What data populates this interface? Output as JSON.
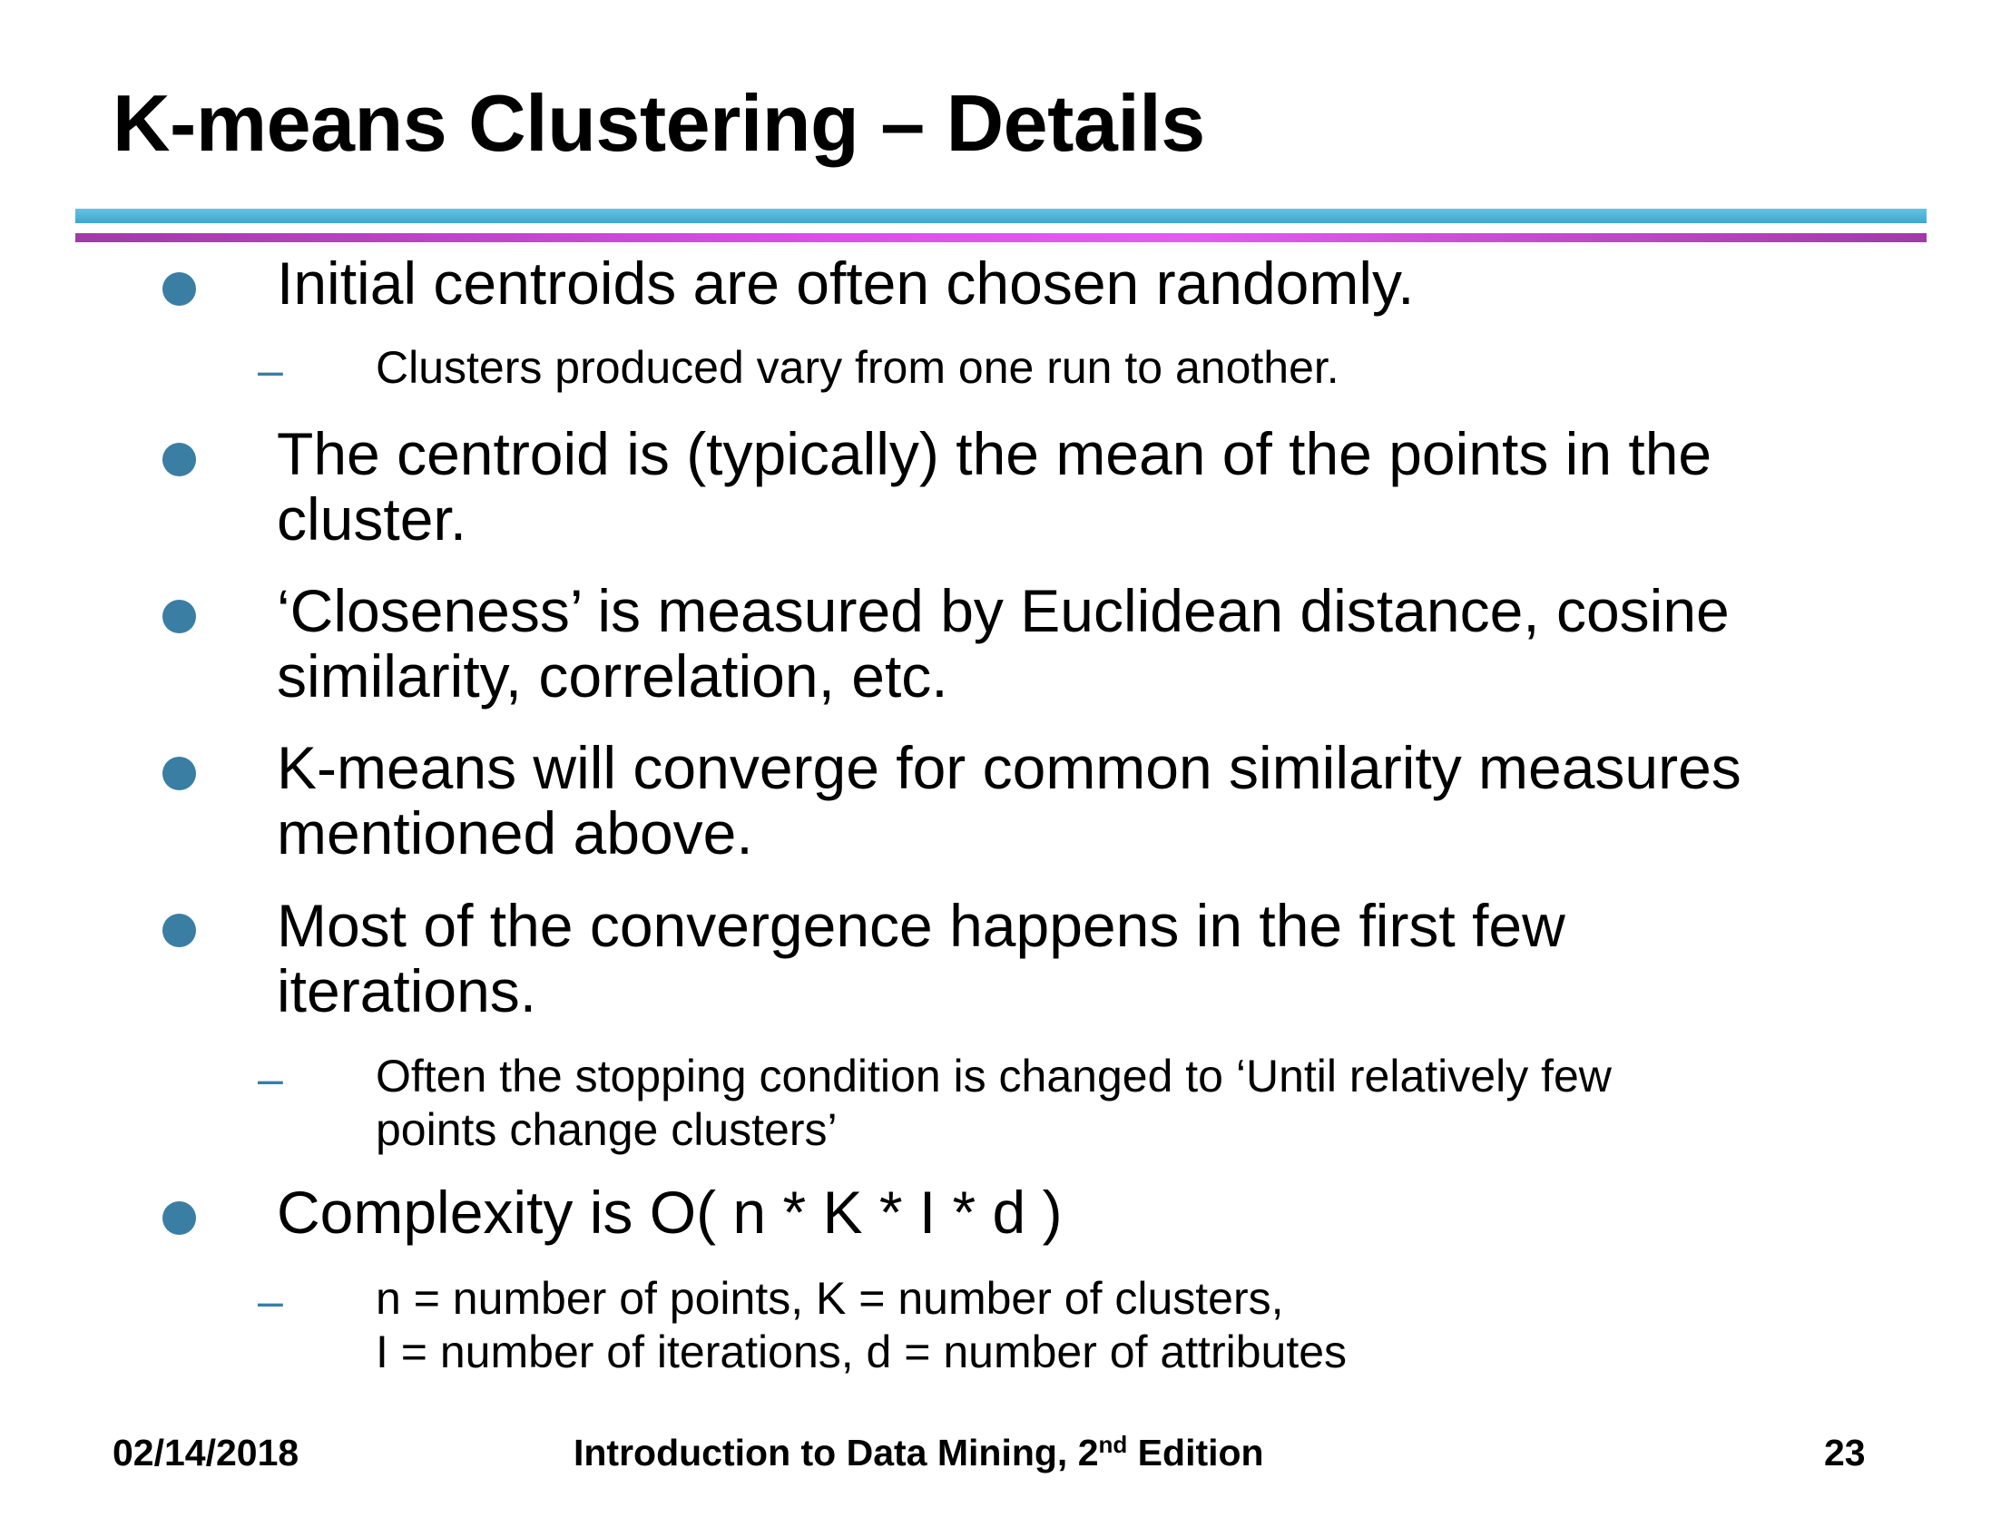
{
  "title": "K-means Clustering – Details",
  "bullets": [
    {
      "lines": [
        "Initial centroids are often chosen randomly."
      ],
      "sub": [
        {
          "lines": [
            "Clusters produced vary from one run to another."
          ]
        }
      ]
    },
    {
      "lines": [
        "The centroid is (typically) the mean of the points in the",
        "cluster."
      ]
    },
    {
      "lines": [
        "‘Closeness’ is measured by Euclidean distance, cosine",
        "similarity, correlation, etc."
      ]
    },
    {
      "lines": [
        "K-means will converge for common similarity measures",
        "mentioned above."
      ]
    },
    {
      "lines": [
        "Most of the convergence happens in the first few",
        "iterations."
      ],
      "sub": [
        {
          "lines": [
            "Often the stopping condition is changed to ‘Until relatively few",
            "points change clusters’"
          ]
        }
      ]
    },
    {
      "lines": [
        "Complexity is O( n * K * I * d )"
      ],
      "sub": [
        {
          "lines": [
            "n = number of points, K = number of clusters,",
            "I = number of iterations, d = number of attributes"
          ]
        }
      ]
    }
  ],
  "footer": {
    "date": "02/14/2018",
    "book_prefix": "Introduction to Data Mining, 2",
    "book_sup": "nd",
    "book_suffix": " Edition",
    "page": "23"
  },
  "colors": {
    "bullet": "#3a7ea4",
    "rule_top": "#3aa7d1",
    "rule_bottom": "#d94fe7"
  }
}
